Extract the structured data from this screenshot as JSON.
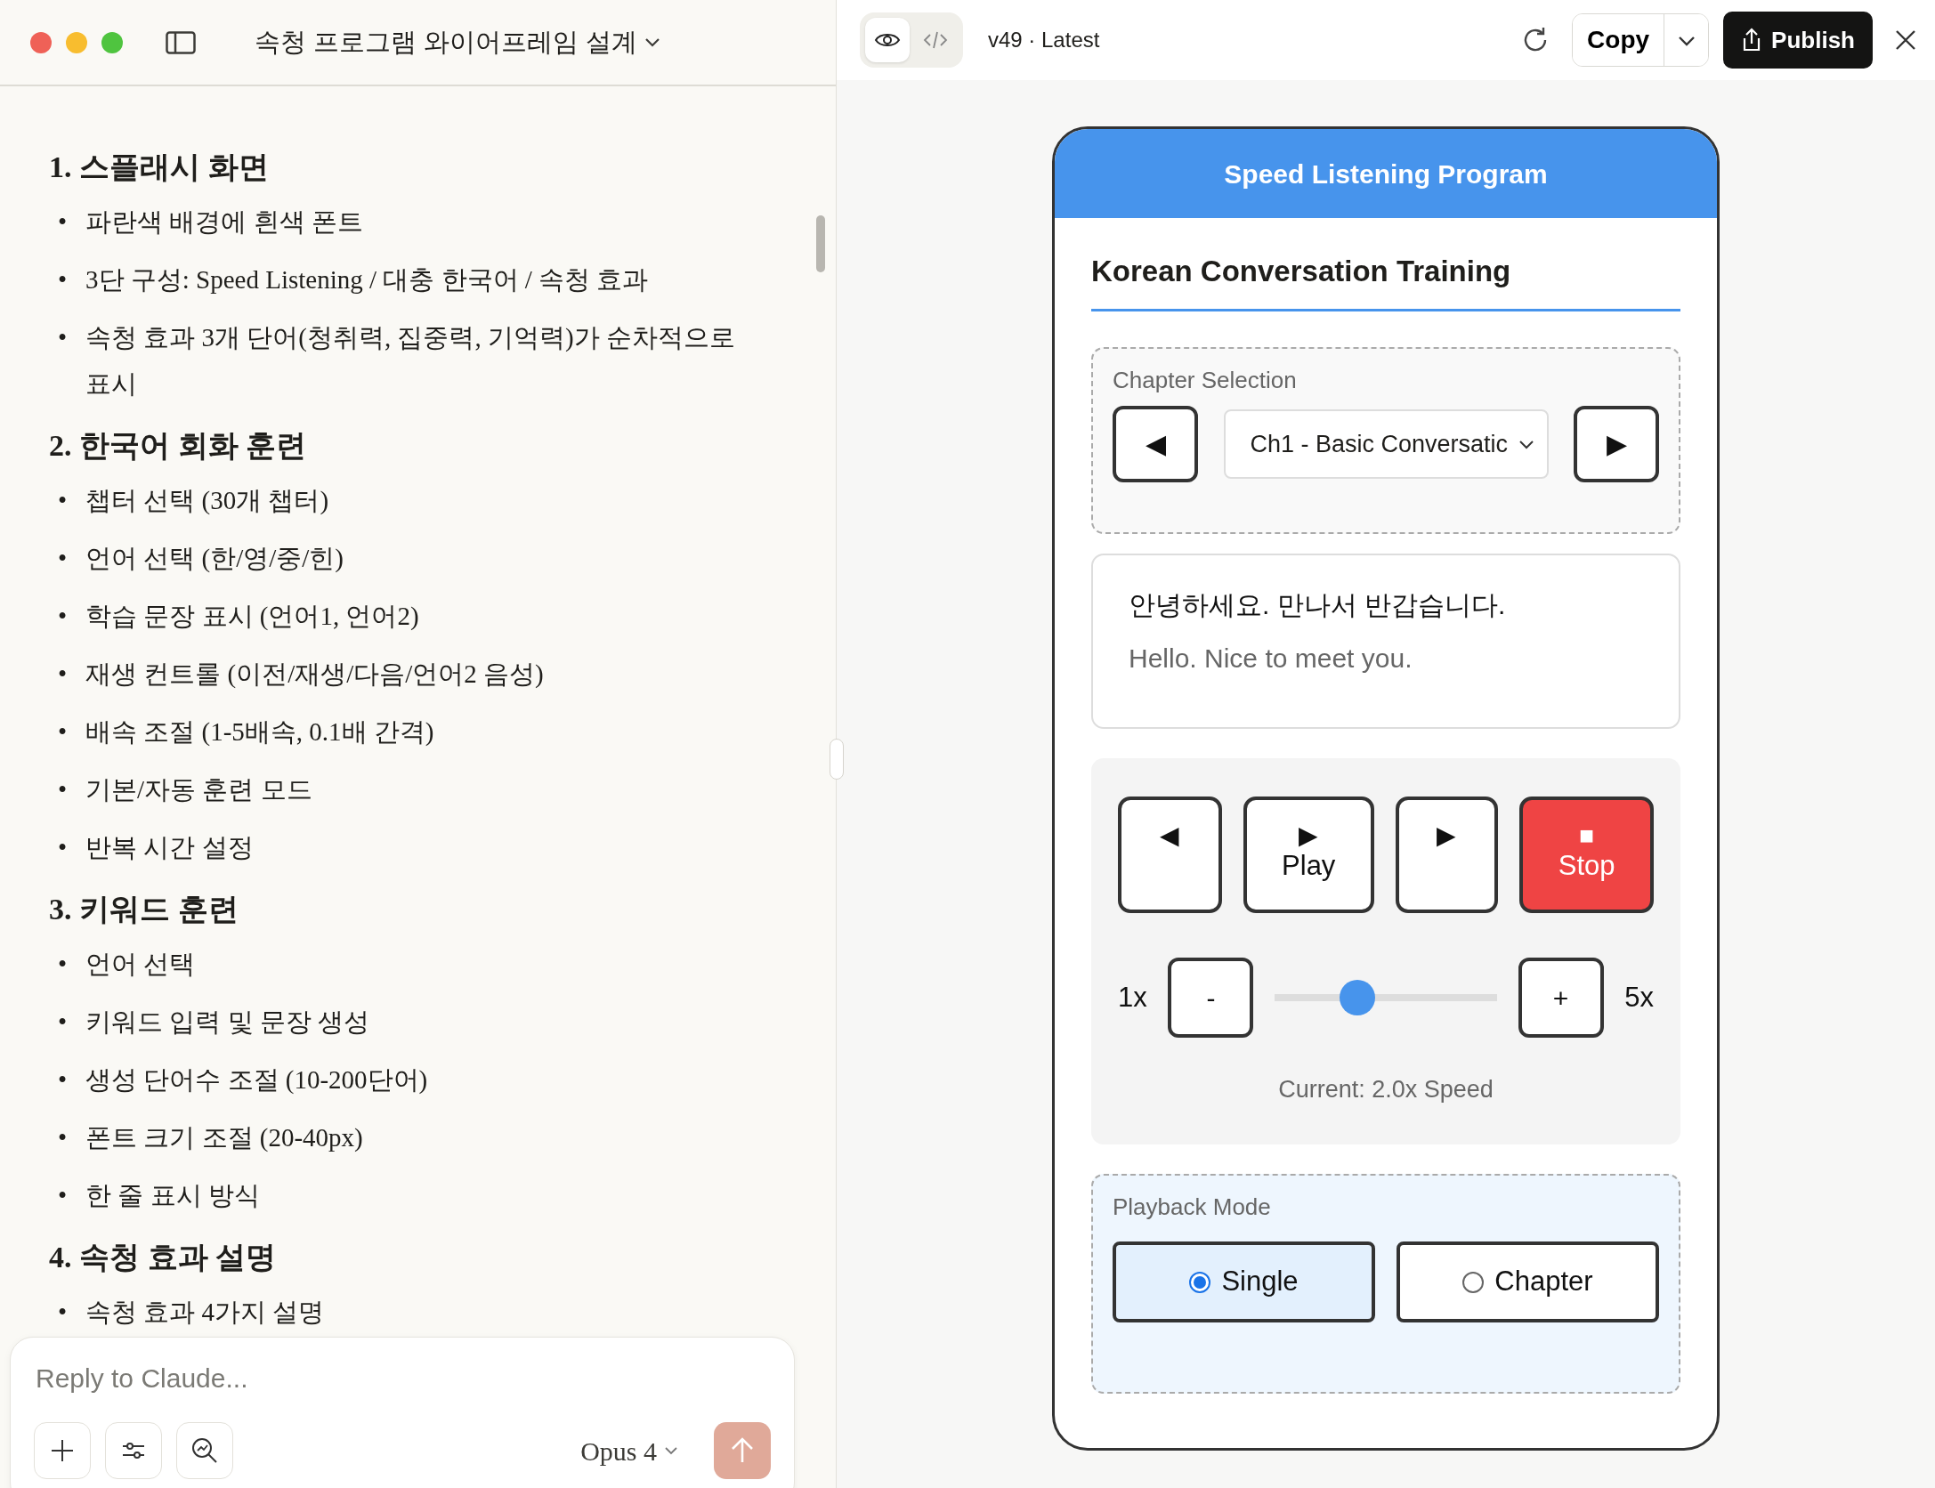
{
  "window": {
    "title": "속청 프로그램 와이어프레임 설계"
  },
  "document": {
    "sections": [
      {
        "heading": "1. 스플래시 화면",
        "items": [
          {
            "bullet": "•",
            "text": "파란색 배경에 흰색 폰트"
          },
          {
            "bullet": "•",
            "text": "3단 구성: Speed Listening / 대충 한국어 / 속청 효과"
          },
          {
            "bullet": "•",
            "text": "속청 효과 3개 단어(청취력, 집중력, 기억력)가 순차적으로 표시"
          }
        ]
      },
      {
        "heading": "2. 한국어 회화 훈련",
        "items": [
          {
            "bullet": "•",
            "text": "챕터 선택 (30개 챕터)"
          },
          {
            "bullet": "•",
            "text": "언어 선택 (한/영/중/힌)"
          },
          {
            "bullet": "•",
            "text": "학습 문장 표시 (언어1, 언어2)"
          },
          {
            "bullet": "•",
            "text": "재생 컨트롤 (이전/재생/다음/언어2 음성)"
          },
          {
            "bullet": "•",
            "text": "배속 조절 (1-5배속, 0.1배 간격)"
          },
          {
            "bullet": "•",
            "text": "기본/자동 훈련 모드"
          },
          {
            "bullet": "•",
            "text": "반복 시간 설정"
          }
        ]
      },
      {
        "heading": "3. 키워드 훈련",
        "items": [
          {
            "bullet": "•",
            "text": "언어 선택"
          },
          {
            "bullet": "•",
            "text": "키워드 입력 및 문장 생성"
          },
          {
            "bullet": "•",
            "text": "생성 단어수 조절 (10-200단어)"
          },
          {
            "bullet": "•",
            "text": "폰트 크기 조절 (20-40px)"
          },
          {
            "bullet": "•",
            "text": "한 줄 표시 방식"
          }
        ]
      },
      {
        "heading": "4. 속청 효과 설명",
        "items": [
          {
            "bullet": "•",
            "text": "속청 효과 4가지 설명"
          }
        ]
      }
    ]
  },
  "composer": {
    "placeholder": "Reply to Claude...",
    "model": "Opus 4"
  },
  "preview_toolbar": {
    "views": [
      {
        "kind": "preview",
        "selected": true
      },
      {
        "kind": "code",
        "selected": false
      }
    ],
    "version": "v49 · Latest",
    "copy_label": "Copy",
    "publish_label": "Publish"
  },
  "app": {
    "title": "Speed Listening Program",
    "heading": "Korean Conversation Training",
    "chapter": {
      "label": "Chapter Selection",
      "prev": "◀",
      "value": "Ch1 - Basic Conversatic",
      "next": "▶"
    },
    "sentence": {
      "primary": "안녕하세요. 만나서 반갑습니다.",
      "secondary": "Hello. Nice to meet you."
    },
    "playback": [
      {
        "kind": "normal",
        "icon": "◀"
      },
      {
        "kind": "normal",
        "icon": "▶",
        "label": "Play"
      },
      {
        "kind": "normal",
        "icon": "▶"
      },
      {
        "kind": "stop",
        "icon": "■",
        "label": "Stop"
      }
    ],
    "speed": {
      "min_label": "1x",
      "minus": "-",
      "level": 0.37,
      "plus": "+",
      "max_label": "5x",
      "current": "Current: 2.0x Speed"
    },
    "mode": {
      "label": "Playback Mode",
      "options": [
        {
          "label": "Single",
          "selected": true
        },
        {
          "label": "Chapter",
          "selected": false
        }
      ]
    }
  }
}
